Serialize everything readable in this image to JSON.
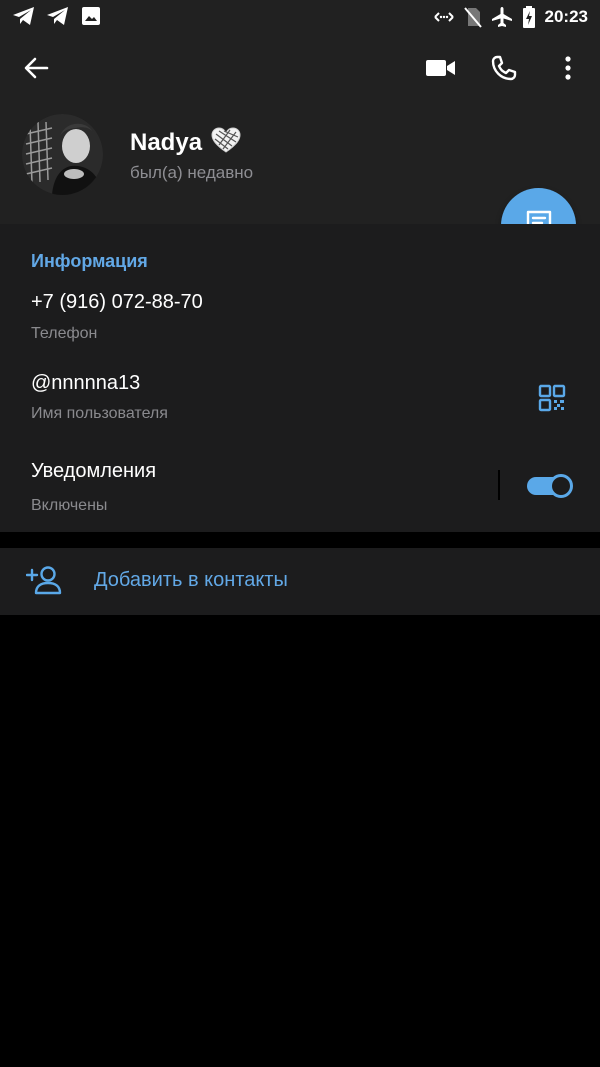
{
  "status_bar": {
    "time": "20:23",
    "left_icons": [
      "telegram-icon",
      "telegram-icon",
      "image-icon"
    ],
    "right_icons": [
      "data-saver-icon",
      "no-sim-icon",
      "airplane-icon",
      "battery-charging-icon"
    ]
  },
  "toolbar": {
    "back_icon": "arrow-left-icon",
    "video_call_icon": "video-camera-icon",
    "call_icon": "phone-icon",
    "more_icon": "more-vertical-icon"
  },
  "profile": {
    "name": "Nadya",
    "name_emoji": "heart-icon",
    "status": "был(а) недавно"
  },
  "fab": {
    "icon": "message-icon"
  },
  "info": {
    "section_title": "Информация",
    "phone": {
      "value": "+7 (916) 072-88-70",
      "label": "Телефон"
    },
    "username": {
      "value": "@nnnnna13",
      "label": "Имя пользователя",
      "icon": "qr-code-icon"
    },
    "notifications": {
      "value": "Уведомления",
      "label": "Включены",
      "enabled": true
    }
  },
  "actions": {
    "add_contact": {
      "label": "Добавить в контакты",
      "icon": "add-user-icon"
    }
  },
  "colors": {
    "accent": "#5aa8e8",
    "link": "#62a8e6",
    "header_bg": "#212121",
    "section_bg": "#1c1c1d",
    "background": "#000000"
  }
}
